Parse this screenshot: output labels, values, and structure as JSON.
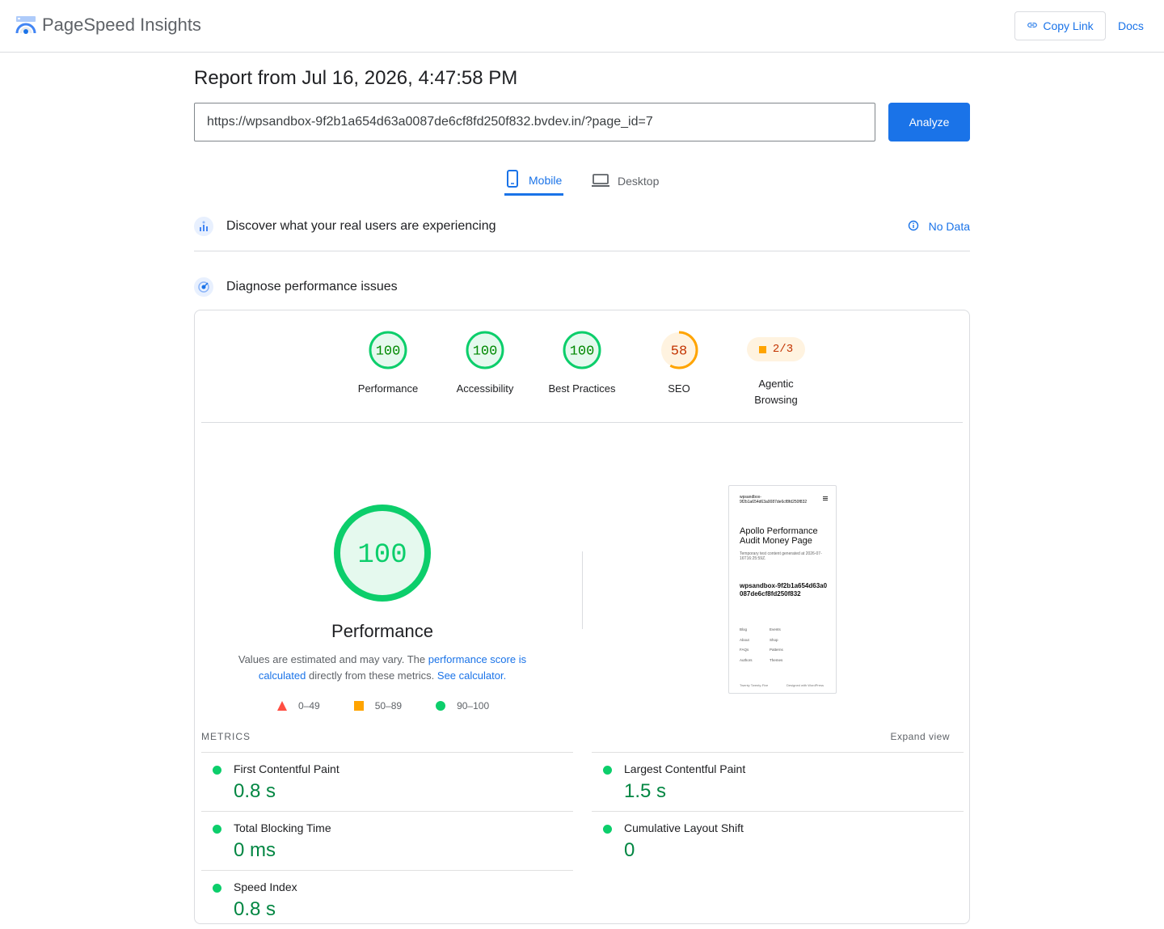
{
  "header": {
    "app_title": "PageSpeed Insights",
    "copy_link_label": "Copy Link",
    "docs_label": "Docs"
  },
  "report": {
    "title": "Report from Jul 16, 2026, 4:47:58 PM",
    "url": "https://wpsandbox-9f2b1a654d63a0087de6cf8fd250f832.bvdev.in/?page_id=7",
    "analyze_label": "Analyze"
  },
  "tabs": [
    {
      "label": "Mobile",
      "active": true
    },
    {
      "label": "Desktop",
      "active": false
    }
  ],
  "field_data": {
    "title": "Discover what your real users are experiencing",
    "status": "No Data"
  },
  "diagnose": {
    "title": "Diagnose performance issues"
  },
  "scores": [
    {
      "label": "Performance",
      "value": "100",
      "score": 1.0,
      "color": "#0cce6b"
    },
    {
      "label": "Accessibility",
      "value": "100",
      "score": 1.0,
      "color": "#0cce6b"
    },
    {
      "label": "Best Practices",
      "value": "100",
      "score": 1.0,
      "color": "#0cce6b"
    },
    {
      "label": "SEO",
      "value": "58",
      "score": 0.58,
      "color": "#ffa400"
    },
    {
      "label": "Agentic Browsing",
      "value": "2/3",
      "color": "#ffa400"
    }
  ],
  "performance": {
    "score": "100",
    "title": "Performance",
    "desc_prefix": "Values are estimated and may vary. The ",
    "desc_link1": "performance score is calculated",
    "desc_mid": " directly from these metrics. ",
    "desc_link2": "See calculator.",
    "legend": [
      "0–49",
      "50–89",
      "90–100"
    ]
  },
  "screenshot": {
    "site": "wpsandbox-9f2b1a654d63a0087de6cf8fd250f832",
    "heading": "Apollo Performance Audit Money Page",
    "sub": "Temporary test content generated at 2026-07-16T16:25:59Z.",
    "big": "wpsandbox-9f2b1a654d63a0087de6cf8fd250f832",
    "links_left": [
      "Blog",
      "About",
      "FAQs",
      "Authors"
    ],
    "links_right": [
      "Events",
      "Shop",
      "Patterns",
      "Themes"
    ],
    "footer_left": "Twenty Twenty-Five",
    "footer_right": "Designed with WordPress"
  },
  "metrics": {
    "heading": "METRICS",
    "expand_label": "Expand view",
    "items": [
      {
        "label": "First Contentful Paint",
        "value": "0.8 s"
      },
      {
        "label": "Largest Contentful Paint",
        "value": "1.5 s"
      },
      {
        "label": "Total Blocking Time",
        "value": "0 ms"
      },
      {
        "label": "Cumulative Layout Shift",
        "value": "0"
      },
      {
        "label": "Speed Index",
        "value": "0.8 s"
      }
    ]
  },
  "colors": {
    "accent": "#1a73e8",
    "pass": "#0cce6b",
    "average": "#ffa400",
    "fail": "#ff4e42"
  }
}
